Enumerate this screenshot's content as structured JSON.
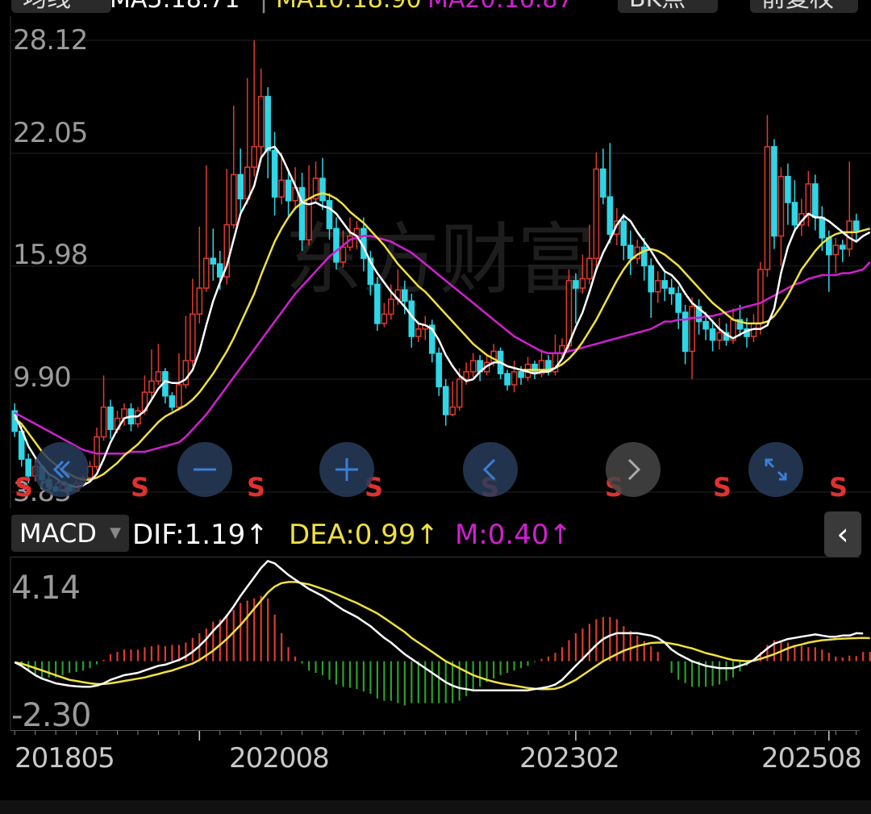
{
  "header": {
    "period": "均线",
    "ma_text": "MA5:18.71",
    "ma10_text": "MA10:18.90",
    "ma20_text": "MA20:16.87",
    "type_label": "BK点",
    "adjust_label": "前复权"
  },
  "price_axis": [
    "28.12",
    "22.05",
    "15.98",
    "9.90",
    "3.83"
  ],
  "watermark": "东方财富",
  "sell_marker": "S",
  "macd": {
    "selector": "MACD",
    "dif": "DIF:1.19↑",
    "dea": "DEA:0.99↑",
    "m": "M:0.40↑",
    "axis": [
      "4.14",
      "-2.30"
    ]
  },
  "dates": [
    "201805",
    "202008",
    "202302",
    "202508"
  ],
  "colors": {
    "up": "#e03a2f",
    "down": "#2ed6e6",
    "ma5": "#ffffff",
    "ma10": "#f0e040",
    "ma20": "#d020d0",
    "dif": "#ffffff",
    "dea": "#f0e040",
    "m": "#d020d0",
    "hist_up": "#e03a2f",
    "hist_down": "#2aa02a"
  },
  "icons": [
    "back-icon",
    "zoom-out-icon",
    "zoom-in-icon",
    "prev-icon",
    "next-icon",
    "fullscreen-icon",
    "collapse-icon"
  ],
  "chart_data": {
    "type": "candlestick",
    "period": "monthly",
    "y_range": [
      3.83,
      28.12
    ],
    "candles": [
      [
        8.2,
        7.1,
        8.6,
        6.8
      ],
      [
        7.1,
        5.6,
        7.4,
        5.2
      ],
      [
        5.6,
        4.7,
        5.9,
        4.3
      ],
      [
        4.7,
        5.2,
        5.6,
        4.4
      ],
      [
        5.2,
        4.5,
        5.3,
        4.1
      ],
      [
        4.5,
        4.1,
        4.8,
        3.9
      ],
      [
        4.1,
        3.9,
        4.3,
        3.83
      ],
      [
        3.9,
        4.2,
        4.4,
        3.85
      ],
      [
        4.2,
        3.9,
        4.3,
        3.83
      ],
      [
        3.9,
        4.3,
        4.5,
        3.85
      ],
      [
        4.3,
        4.6,
        4.8,
        4.1
      ],
      [
        4.6,
        5.2,
        5.5,
        4.4
      ],
      [
        5.2,
        6.8,
        7.3,
        5.0
      ],
      [
        6.8,
        8.4,
        10.1,
        6.6
      ],
      [
        8.4,
        7.2,
        8.8,
        6.7
      ],
      [
        7.2,
        7.8,
        8.2,
        7.0
      ],
      [
        7.8,
        8.3,
        8.6,
        7.4
      ],
      [
        8.3,
        7.5,
        8.6,
        7.1
      ],
      [
        7.5,
        8.2,
        8.4,
        7.3
      ],
      [
        8.2,
        9.2,
        10.1,
        8.0
      ],
      [
        9.2,
        9.8,
        11.5,
        8.9
      ],
      [
        9.8,
        10.3,
        11.8,
        9.6
      ],
      [
        10.3,
        9.0,
        10.5,
        8.6
      ],
      [
        9.0,
        8.4,
        9.2,
        8.2
      ],
      [
        8.4,
        9.6,
        11.3,
        8.2
      ],
      [
        9.6,
        10.9,
        13.3,
        9.4
      ],
      [
        10.9,
        13.4,
        15.3,
        10.6
      ],
      [
        13.4,
        14.8,
        18.1,
        12.9
      ],
      [
        14.8,
        16.4,
        21.4,
        14.6
      ],
      [
        16.4,
        16.1,
        18.0,
        15.2
      ],
      [
        16.1,
        15.4,
        16.8,
        14.7
      ],
      [
        15.4,
        18.2,
        21.2,
        15.0
      ],
      [
        18.2,
        20.9,
        24.6,
        18.0
      ],
      [
        20.9,
        19.6,
        22.3,
        18.9
      ],
      [
        19.6,
        21.3,
        26.1,
        19.3
      ],
      [
        21.3,
        22.4,
        28.12,
        20.8
      ],
      [
        22.4,
        25.1,
        26.6,
        21.6
      ],
      [
        25.1,
        22.2,
        25.6,
        20.7
      ],
      [
        22.2,
        19.7,
        23.2,
        18.7
      ],
      [
        19.7,
        20.6,
        22.1,
        19.3
      ],
      [
        20.6,
        19.5,
        21.1,
        18.7
      ],
      [
        19.5,
        20.2,
        21.3,
        19.0
      ],
      [
        20.2,
        17.4,
        21.0,
        16.8
      ],
      [
        17.4,
        19.6,
        21.4,
        17.1
      ],
      [
        19.6,
        20.7,
        21.6,
        19.4
      ],
      [
        20.7,
        19.5,
        21.8,
        19.0
      ],
      [
        19.5,
        18.0,
        19.9,
        17.4
      ],
      [
        18.0,
        16.2,
        18.6,
        15.8
      ],
      [
        16.2,
        17.0,
        17.9,
        15.9
      ],
      [
        17.0,
        17.6,
        18.6,
        16.8
      ],
      [
        17.6,
        18.0,
        18.4,
        16.9
      ],
      [
        18.0,
        16.4,
        18.6,
        15.7
      ],
      [
        16.4,
        15.0,
        16.8,
        14.4
      ],
      [
        15.0,
        12.9,
        15.4,
        12.5
      ],
      [
        12.9,
        13.4,
        14.0,
        12.7
      ],
      [
        13.4,
        14.2,
        15.0,
        13.1
      ],
      [
        14.2,
        14.7,
        15.8,
        13.9
      ],
      [
        14.7,
        14.1,
        15.2,
        13.4
      ],
      [
        14.1,
        12.2,
        14.5,
        11.6
      ],
      [
        12.2,
        12.6,
        13.0,
        11.9
      ],
      [
        12.6,
        12.8,
        13.3,
        12.0
      ],
      [
        12.8,
        11.3,
        13.1,
        10.8
      ],
      [
        11.3,
        9.5,
        11.6,
        9.0
      ],
      [
        9.5,
        8.0,
        9.9,
        7.4
      ],
      [
        8.0,
        8.4,
        9.8,
        7.9
      ],
      [
        8.4,
        9.9,
        10.5,
        8.2
      ],
      [
        9.9,
        10.3,
        10.8,
        9.6
      ],
      [
        10.3,
        10.9,
        11.3,
        10.0
      ],
      [
        10.9,
        10.3,
        11.2,
        9.8
      ],
      [
        10.3,
        10.8,
        11.2,
        10.1
      ],
      [
        10.8,
        11.4,
        11.8,
        10.6
      ],
      [
        11.4,
        10.2,
        11.6,
        9.9
      ],
      [
        10.2,
        9.6,
        10.4,
        9.3
      ],
      [
        9.6,
        10.3,
        10.9,
        9.2
      ],
      [
        10.3,
        10.0,
        10.6,
        9.6
      ],
      [
        10.0,
        10.7,
        11.1,
        9.8
      ],
      [
        10.7,
        10.2,
        10.9,
        9.9
      ],
      [
        10.2,
        10.9,
        11.5,
        10.0
      ],
      [
        10.9,
        10.3,
        11.2,
        10.1
      ],
      [
        10.3,
        11.3,
        12.3,
        10.1
      ],
      [
        11.3,
        11.7,
        12.1,
        11.1
      ],
      [
        11.7,
        15.2,
        15.8,
        11.4
      ],
      [
        15.2,
        14.8,
        15.6,
        12.9
      ],
      [
        14.8,
        15.3,
        16.6,
        14.5
      ],
      [
        15.3,
        16.4,
        18.2,
        15.0
      ],
      [
        16.4,
        21.2,
        22.1,
        15.8
      ],
      [
        21.2,
        19.7,
        22.3,
        19.3
      ],
      [
        19.7,
        17.7,
        22.6,
        17.2
      ],
      [
        17.7,
        18.4,
        19.1,
        17.1
      ],
      [
        18.4,
        17.1,
        18.8,
        16.3
      ],
      [
        17.1,
        16.4,
        17.9,
        15.5
      ],
      [
        16.4,
        17.0,
        17.4,
        16.1
      ],
      [
        17.0,
        16.0,
        17.5,
        15.2
      ],
      [
        16.0,
        14.6,
        16.4,
        13.2
      ],
      [
        14.6,
        15.2,
        15.7,
        14.0
      ],
      [
        15.2,
        14.8,
        15.7,
        14.1
      ],
      [
        14.8,
        14.5,
        15.3,
        13.9
      ],
      [
        14.5,
        13.5,
        14.9,
        12.6
      ],
      [
        13.5,
        11.4,
        13.9,
        10.7
      ],
      [
        11.4,
        13.8,
        14.3,
        9.9
      ],
      [
        13.8,
        13.0,
        14.2,
        12.3
      ],
      [
        13.0,
        12.6,
        13.5,
        12.0
      ],
      [
        12.6,
        12.0,
        13.1,
        11.4
      ],
      [
        12.0,
        12.4,
        13.2,
        11.5
      ],
      [
        12.4,
        12.0,
        12.9,
        11.7
      ],
      [
        12.0,
        13.1,
        13.7,
        11.8
      ],
      [
        13.1,
        12.6,
        13.9,
        12.2
      ],
      [
        12.6,
        12.2,
        13.2,
        11.6
      ],
      [
        12.2,
        12.9,
        13.4,
        11.9
      ],
      [
        12.9,
        15.8,
        16.2,
        12.3
      ],
      [
        15.8,
        22.4,
        24.1,
        15.4
      ],
      [
        22.4,
        17.6,
        22.8,
        16.9
      ],
      [
        17.6,
        20.8,
        21.3,
        16.0
      ],
      [
        20.8,
        19.4,
        21.5,
        18.2
      ],
      [
        19.4,
        18.2,
        20.6,
        17.8
      ],
      [
        18.2,
        18.8,
        19.6,
        17.6
      ],
      [
        18.8,
        20.4,
        21.1,
        18.1
      ],
      [
        20.4,
        18.6,
        20.9,
        17.9
      ],
      [
        18.6,
        17.5,
        19.2,
        16.8
      ],
      [
        17.5,
        16.6,
        17.9,
        14.6
      ],
      [
        16.6,
        17.1,
        17.5,
        15.6
      ],
      [
        17.1,
        16.9,
        17.4,
        16.2
      ],
      [
        16.9,
        18.4,
        21.6,
        16.5
      ],
      [
        18.4,
        17.9,
        18.8,
        17.3
      ]
    ],
    "ma5": [
      8.0,
      7.2,
      6.3,
      5.7,
      5.2,
      4.8,
      4.6,
      4.3,
      4.2,
      4.1,
      4.2,
      4.4,
      4.8,
      5.6,
      6.5,
      7.2,
      7.8,
      7.9,
      7.9,
      8.2,
      8.8,
      9.4,
      9.8,
      9.7,
      9.7,
      9.9,
      10.4,
      11.4,
      12.8,
      14.1,
      15.1,
      16.0,
      17.4,
      18.8,
      19.5,
      20.3,
      21.8,
      22.3,
      22.4,
      21.9,
      21.1,
      20.3,
      19.4,
      19.3,
      19.4,
      19.2,
      19.1,
      18.8,
      18.3,
      17.8,
      17.6,
      17.0,
      16.2,
      15.6,
      15.1,
      14.6,
      14.2,
      13.8,
      13.3,
      12.9,
      12.8,
      12.6,
      12.0,
      11.2,
      10.6,
      10.1,
      9.8,
      9.9,
      10.3,
      10.6,
      10.8,
      10.8,
      10.6,
      10.5,
      10.4,
      10.3,
      10.2,
      10.3,
      10.3,
      10.5,
      11.0,
      11.8,
      12.7,
      13.5,
      14.6,
      15.8,
      16.7,
      17.4,
      18.2,
      18.7,
      18.4,
      17.8,
      17.3,
      16.8,
      16.2,
      15.7,
      15.5,
      15.1,
      14.5,
      14.0,
      13.7,
      13.4,
      13.0,
      12.6,
      12.3,
      12.1,
      12.3,
      12.5,
      12.6,
      12.6,
      12.8,
      13.7,
      15.6,
      17.0,
      17.9,
      18.4,
      18.8,
      18.6,
      18.6,
      18.4,
      18.1,
      17.8,
      17.5,
      17.3,
      17.6,
      17.8
    ],
    "ma10": [
      7.8,
      7.5,
      7.0,
      6.5,
      6.0,
      5.6,
      5.3,
      5.0,
      4.8,
      4.6,
      4.5,
      4.5,
      4.6,
      4.8,
      5.1,
      5.4,
      5.8,
      6.1,
      6.4,
      6.8,
      7.2,
      7.6,
      7.9,
      8.1,
      8.3,
      8.5,
      8.8,
      9.2,
      9.7,
      10.2,
      10.8,
      11.4,
      12.1,
      12.9,
      13.7,
      14.5,
      15.5,
      16.4,
      17.3,
      18.0,
      18.6,
      19.1,
      19.4,
      19.6,
      19.8,
      19.9,
      19.8,
      19.6,
      19.3,
      18.9,
      18.6,
      18.3,
      17.9,
      17.5,
      17.1,
      16.6,
      16.1,
      15.7,
      15.3,
      14.9,
      14.6,
      14.2,
      13.8,
      13.4,
      13.0,
      12.6,
      12.2,
      11.8,
      11.5,
      11.2,
      11.0,
      10.8,
      10.6,
      10.5,
      10.4,
      10.4,
      10.4,
      10.4,
      10.4,
      10.5,
      10.7,
      11.0,
      11.4,
      11.9,
      12.5,
      13.1,
      13.8,
      14.5,
      15.2,
      15.8,
      16.3,
      16.6,
      16.8,
      16.9,
      16.8,
      16.6,
      16.3,
      16.0,
      15.6,
      15.2,
      14.8,
      14.4,
      14.0,
      13.7,
      13.4,
      13.1,
      13.0,
      12.9,
      12.9,
      12.9,
      13.0,
      13.3,
      13.8,
      14.4,
      15.1,
      15.8,
      16.3,
      16.8,
      17.2,
      17.5,
      17.7,
      17.8,
      17.8,
      17.8,
      17.9,
      18.0
    ],
    "ma20": [
      8.1,
      7.9,
      7.7,
      7.5,
      7.3,
      7.1,
      6.9,
      6.7,
      6.5,
      6.3,
      6.1,
      6.0,
      5.9,
      5.9,
      5.9,
      5.9,
      5.9,
      6.0,
      6.0,
      6.0,
      6.1,
      6.2,
      6.3,
      6.4,
      6.5,
      6.8,
      7.2,
      7.6,
      8.0,
      8.5,
      9.0,
      9.5,
      10.0,
      10.5,
      11.0,
      11.5,
      12.0,
      12.5,
      13.0,
      13.5,
      14.0,
      14.5,
      14.9,
      15.3,
      15.7,
      16.1,
      16.5,
      16.8,
      17.1,
      17.4,
      17.5,
      17.6,
      17.6,
      17.5,
      17.4,
      17.3,
      17.1,
      16.9,
      16.7,
      16.4,
      16.1,
      15.8,
      15.5,
      15.2,
      14.9,
      14.6,
      14.3,
      14.0,
      13.7,
      13.4,
      13.1,
      12.8,
      12.5,
      12.2,
      12.0,
      11.8,
      11.6,
      11.4,
      11.3,
      11.3,
      11.3,
      11.4,
      11.5,
      11.6,
      11.7,
      11.8,
      11.9,
      12.0,
      12.1,
      12.2,
      12.3,
      12.4,
      12.5,
      12.6,
      12.8,
      13.0,
      13.0,
      13.1,
      13.1,
      13.2,
      13.2,
      13.3,
      13.3,
      13.4,
      13.5,
      13.6,
      13.7,
      13.8,
      13.9,
      14.0,
      14.2,
      14.4,
      14.6,
      14.8,
      15.0,
      15.1,
      15.3,
      15.4,
      15.5,
      15.5,
      15.5,
      15.6,
      15.6,
      15.7,
      15.8,
      16.2
    ],
    "macd": {
      "y_range": [
        -2.3,
        4.14
      ],
      "dif": [
        -0.05,
        -0.2,
        -0.4,
        -0.6,
        -0.75,
        -0.85,
        -0.95,
        -1.0,
        -1.05,
        -1.08,
        -1.1,
        -1.1,
        -1.05,
        -0.95,
        -0.8,
        -0.7,
        -0.6,
        -0.55,
        -0.5,
        -0.4,
        -0.3,
        -0.2,
        -0.15,
        -0.05,
        0.05,
        0.2,
        0.4,
        0.65,
        0.95,
        1.3,
        1.6,
        1.95,
        2.35,
        2.8,
        3.2,
        3.6,
        4.0,
        4.3,
        4.2,
        3.95,
        3.7,
        3.5,
        3.3,
        3.1,
        2.95,
        2.8,
        2.6,
        2.4,
        2.2,
        2.05,
        1.9,
        1.7,
        1.5,
        1.25,
        1.0,
        0.8,
        0.55,
        0.3,
        0.1,
        -0.1,
        -0.3,
        -0.5,
        -0.7,
        -0.9,
        -1.05,
        -1.15,
        -1.2,
        -1.25,
        -1.25,
        -1.25,
        -1.25,
        -1.25,
        -1.25,
        -1.25,
        -1.25,
        -1.25,
        -1.2,
        -1.15,
        -1.1,
        -1.0,
        -0.8,
        -0.5,
        -0.2,
        0.1,
        0.4,
        0.7,
        0.95,
        1.1,
        1.2,
        1.2,
        1.2,
        1.2,
        1.15,
        1.1,
        1.0,
        0.8,
        0.5,
        0.3,
        0.15,
        0.0,
        -0.1,
        -0.2,
        -0.25,
        -0.3,
        -0.3,
        -0.3,
        -0.2,
        -0.1,
        0.05,
        0.3,
        0.55,
        0.75,
        0.85,
        0.95,
        1.0,
        1.05,
        1.1,
        1.15,
        1.1,
        1.05,
        1.05,
        1.1,
        1.1,
        1.2,
        1.19
      ],
      "dea": [
        -0.05,
        -0.1,
        -0.2,
        -0.3,
        -0.4,
        -0.5,
        -0.6,
        -0.7,
        -0.8,
        -0.85,
        -0.9,
        -0.95,
        -0.98,
        -0.98,
        -0.95,
        -0.9,
        -0.85,
        -0.8,
        -0.75,
        -0.7,
        -0.62,
        -0.55,
        -0.47,
        -0.4,
        -0.3,
        -0.2,
        -0.1,
        0.05,
        0.25,
        0.45,
        0.7,
        0.95,
        1.25,
        1.55,
        1.9,
        2.25,
        2.6,
        2.95,
        3.2,
        3.35,
        3.4,
        3.4,
        3.35,
        3.3,
        3.2,
        3.1,
        3.0,
        2.88,
        2.75,
        2.62,
        2.5,
        2.35,
        2.2,
        2.05,
        1.85,
        1.65,
        1.45,
        1.25,
        1.0,
        0.8,
        0.6,
        0.4,
        0.2,
        0.0,
        -0.15,
        -0.3,
        -0.45,
        -0.6,
        -0.7,
        -0.8,
        -0.88,
        -0.95,
        -1.0,
        -1.05,
        -1.1,
        -1.15,
        -1.18,
        -1.2,
        -1.2,
        -1.18,
        -1.1,
        -0.95,
        -0.8,
        -0.6,
        -0.4,
        -0.2,
        0.0,
        0.15,
        0.3,
        0.45,
        0.55,
        0.65,
        0.72,
        0.78,
        0.8,
        0.8,
        0.75,
        0.7,
        0.62,
        0.55,
        0.45,
        0.35,
        0.28,
        0.2,
        0.12,
        0.05,
        0.02,
        0.0,
        0.02,
        0.1,
        0.2,
        0.3,
        0.42,
        0.55,
        0.65,
        0.72,
        0.8,
        0.85,
        0.9,
        0.92,
        0.95,
        0.97,
        0.98,
        0.99,
        1.0,
        0.99
      ],
      "m": [
        0.0,
        -0.2,
        -0.4,
        -0.6,
        -0.7,
        -0.7,
        -0.7,
        -0.6,
        -0.5,
        -0.46,
        -0.4,
        -0.3,
        -0.14,
        0.06,
        0.3,
        0.4,
        0.5,
        0.5,
        0.5,
        0.6,
        0.64,
        0.7,
        0.64,
        0.7,
        0.7,
        0.8,
        1.0,
        1.2,
        1.4,
        1.7,
        1.8,
        2.0,
        2.2,
        2.5,
        2.6,
        2.7,
        2.8,
        2.7,
        2.0,
        1.2,
        0.6,
        0.2,
        -0.1,
        -0.4,
        -0.5,
        -0.6,
        -0.8,
        -1.0,
        -1.1,
        -1.14,
        -1.2,
        -1.3,
        -1.4,
        -1.6,
        -1.7,
        -1.7,
        -1.8,
        -1.9,
        -1.8,
        -1.8,
        -1.8,
        -1.8,
        -1.8,
        -1.8,
        -1.8,
        -1.7,
        -1.5,
        -1.3,
        -1.1,
        -0.9,
        -0.74,
        -0.6,
        -0.5,
        -0.4,
        -0.3,
        -0.2,
        -0.04,
        0.1,
        0.2,
        0.36,
        0.6,
        0.9,
        1.2,
        1.4,
        1.6,
        1.8,
        1.9,
        1.9,
        1.8,
        1.5,
        1.3,
        1.1,
        0.86,
        0.64,
        0.4,
        0.0,
        -0.5,
        -0.8,
        -0.94,
        -1.1,
        -1.1,
        -1.1,
        -1.06,
        -1.0,
        -0.84,
        -0.7,
        -0.44,
        -0.2,
        0.06,
        0.4,
        0.7,
        0.9,
        0.86,
        0.8,
        0.7,
        0.66,
        0.6,
        0.6,
        0.5,
        0.36,
        0.2,
        0.16,
        0.24,
        0.22,
        0.4,
        0.4
      ]
    }
  }
}
